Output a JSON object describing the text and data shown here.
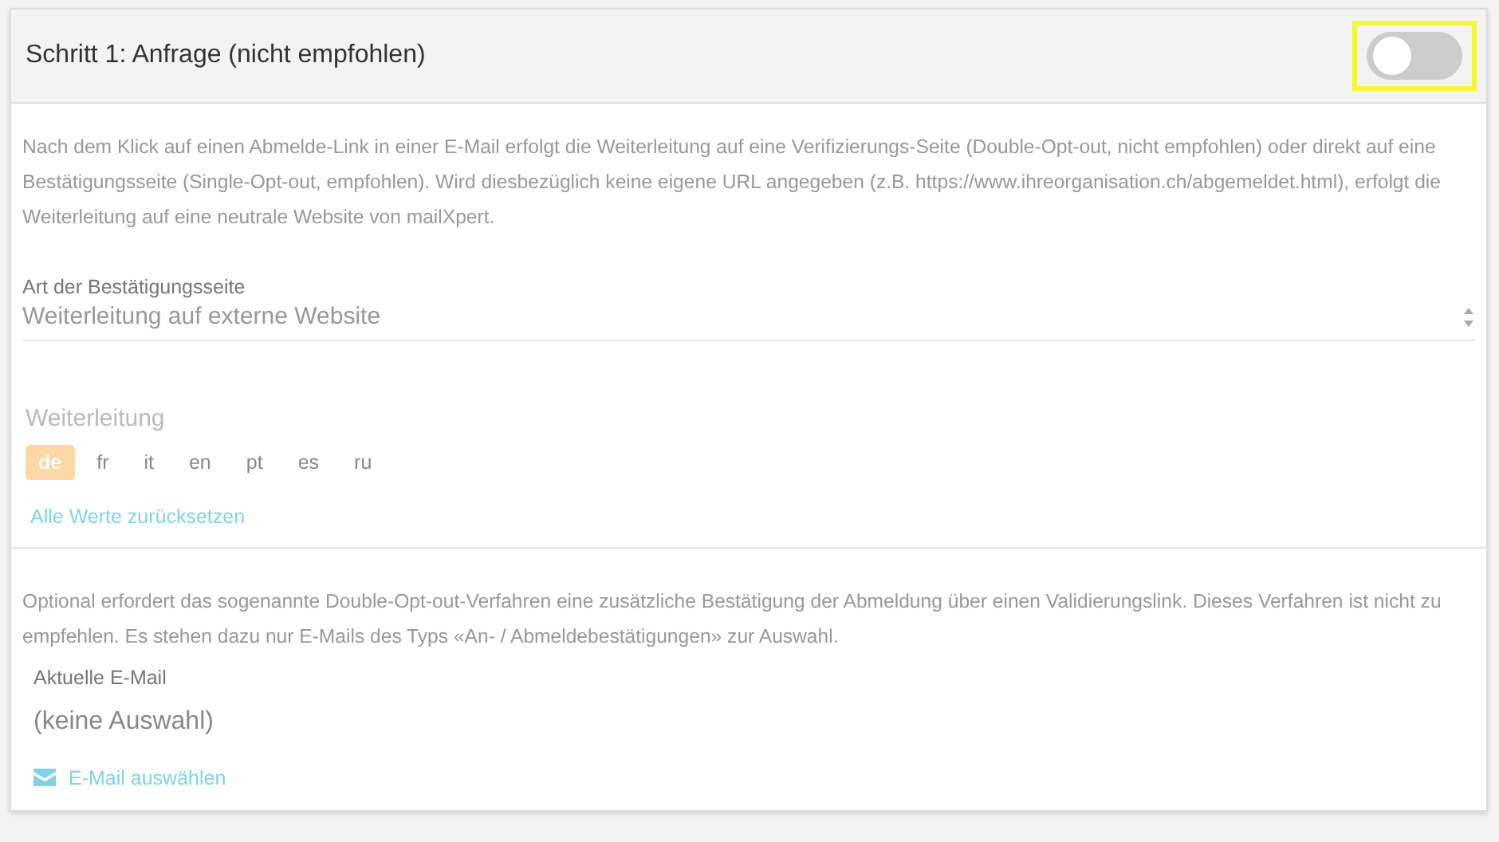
{
  "header": {
    "title": "Schritt 1: Anfrage (nicht empfohlen)",
    "toggle": {
      "on": false,
      "highlighted": true
    }
  },
  "intro": "Nach dem Klick auf einen Abmelde-Link in einer E-Mail erfolgt die Weiterleitung auf eine Verifizierungs-Seite (Double-Opt-out, nicht empfohlen) oder direkt auf eine Bestätigungsseite (Single-Opt-out, empfohlen). Wird diesbezüglich keine eigene URL angegeben (z.B. https://www.ihreorganisation.ch/abgemeldet.html), erfolgt die Weiterleitung auf eine neutrale Website von mailXpert.",
  "page_type": {
    "label": "Art der Bestätigungsseite",
    "value": "Weiterleitung auf externe Website"
  },
  "redirect": {
    "label": "Weiterleitung",
    "languages": [
      {
        "code": "de",
        "selected": true
      },
      {
        "code": "fr",
        "selected": false
      },
      {
        "code": "it",
        "selected": false
      },
      {
        "code": "en",
        "selected": false
      },
      {
        "code": "pt",
        "selected": false
      },
      {
        "code": "es",
        "selected": false
      },
      {
        "code": "ru",
        "selected": false
      }
    ],
    "reset_link": "Alle Werte zurücksetzen"
  },
  "optional_text": "Optional erfordert das sogenannte Double-Opt-out-Verfahren eine zusätzliche Bestätigung der Abmeldung über einen Validierungslink. Dieses Verfahren ist nicht zu empfehlen. Es stehen dazu nur E-Mails des Typs «An- / Abmeldebestätigungen» zur Auswahl.",
  "current_email": {
    "label": "Aktuelle E-Mail",
    "value": "(keine Auswahl)",
    "select_link": "E-Mail auswählen"
  }
}
